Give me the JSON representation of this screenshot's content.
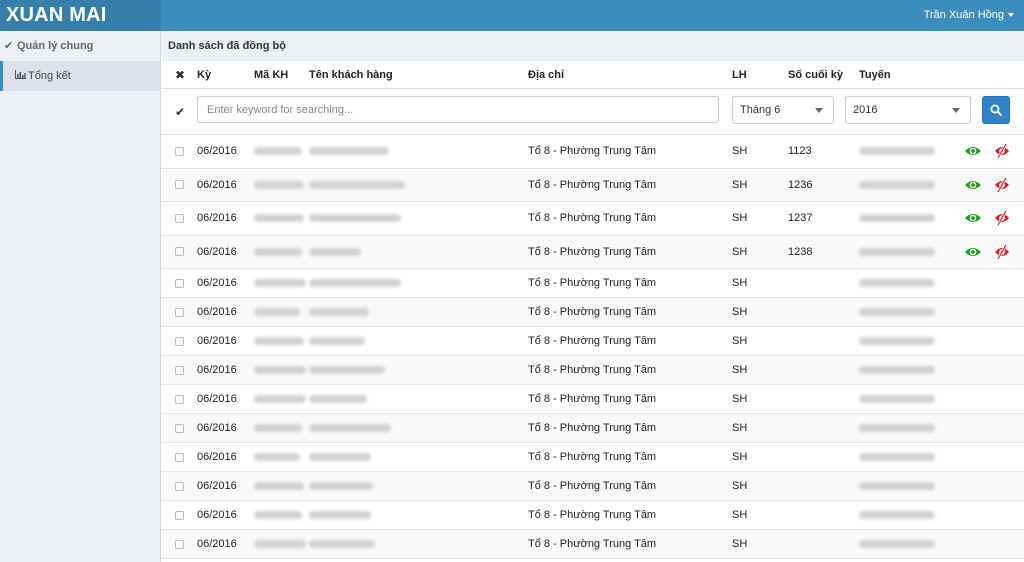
{
  "app": {
    "brand": "XUAN MAI",
    "user": "Trần Xuân Hồng"
  },
  "sidebar": {
    "items": [
      {
        "label": "Quản lý chung"
      },
      {
        "label": "Tổng kết"
      }
    ]
  },
  "page": {
    "title": "Danh sách đã đồng bộ"
  },
  "table": {
    "headers": {
      "clear": "✖",
      "ky": "Kỳ",
      "ma_kh": "Mã KH",
      "ten_kh": "Tên khách hàng",
      "dia_chi": "Địa chỉ",
      "lh": "LH",
      "so_cuoi_ky": "Số cuối kỳ",
      "tuyen": "Tuyến"
    },
    "filter": {
      "check": "✔",
      "search_placeholder": "Enter keyword for searching...",
      "month_selected": "Tháng 6",
      "year_selected": "2016"
    },
    "rows": [
      {
        "ky": "06/2016",
        "dia_chi": "Tổ 8 - Phường Trung Tâm",
        "lh": "SH",
        "so_cuoi_ky": "1123",
        "actions": true
      },
      {
        "ky": "06/2016",
        "dia_chi": "Tổ 8 - Phường Trung Tâm",
        "lh": "SH",
        "so_cuoi_ky": "1236",
        "actions": true
      },
      {
        "ky": "06/2016",
        "dia_chi": "Tổ 8 - Phường Trung Tâm",
        "lh": "SH",
        "so_cuoi_ky": "1237",
        "actions": true
      },
      {
        "ky": "06/2016",
        "dia_chi": "Tổ 8 - Phường Trung Tâm",
        "lh": "SH",
        "so_cuoi_ky": "1238",
        "actions": true
      },
      {
        "ky": "06/2016",
        "dia_chi": "Tổ 8 - Phường Trung Tâm",
        "lh": "SH",
        "so_cuoi_ky": "",
        "actions": false
      },
      {
        "ky": "06/2016",
        "dia_chi": "Tổ 8 - Phường Trung Tâm",
        "lh": "SH",
        "so_cuoi_ky": "",
        "actions": false
      },
      {
        "ky": "06/2016",
        "dia_chi": "Tổ 8 - Phường Trung Tâm",
        "lh": "SH",
        "so_cuoi_ky": "",
        "actions": false
      },
      {
        "ky": "06/2016",
        "dia_chi": "Tổ 8 - Phường Trung Tâm",
        "lh": "SH",
        "so_cuoi_ky": "",
        "actions": false
      },
      {
        "ky": "06/2016",
        "dia_chi": "Tổ 8 - Phường Trung Tâm",
        "lh": "SH",
        "so_cuoi_ky": "",
        "actions": false
      },
      {
        "ky": "06/2016",
        "dia_chi": "Tổ 8 - Phường Trung Tâm",
        "lh": "SH",
        "so_cuoi_ky": "",
        "actions": false
      },
      {
        "ky": "06/2016",
        "dia_chi": "Tổ 8 - Phường Trung Tâm",
        "lh": "SH",
        "so_cuoi_ky": "",
        "actions": false
      },
      {
        "ky": "06/2016",
        "dia_chi": "Tổ 8 - Phường Trung Tâm",
        "lh": "SH",
        "so_cuoi_ky": "",
        "actions": false
      },
      {
        "ky": "06/2016",
        "dia_chi": "Tổ 8 - Phường Trung Tâm",
        "lh": "SH",
        "so_cuoi_ky": "",
        "actions": false
      },
      {
        "ky": "06/2016",
        "dia_chi": "Tổ 8 - Phường Trung Tâm",
        "lh": "SH",
        "so_cuoi_ky": "",
        "actions": false
      }
    ]
  },
  "icons": {
    "view": "eye-icon",
    "delete": "delete-icon",
    "search": "search-icon",
    "chart": "chart-icon",
    "check": "check-icon",
    "clear": "close-icon"
  },
  "colors": {
    "topbar": "#3c8dbc",
    "brand_bg": "#367fa9",
    "view_icon": "#1e9e1e",
    "delete_icon": "#e02020",
    "search_button": "#2e82c7"
  }
}
